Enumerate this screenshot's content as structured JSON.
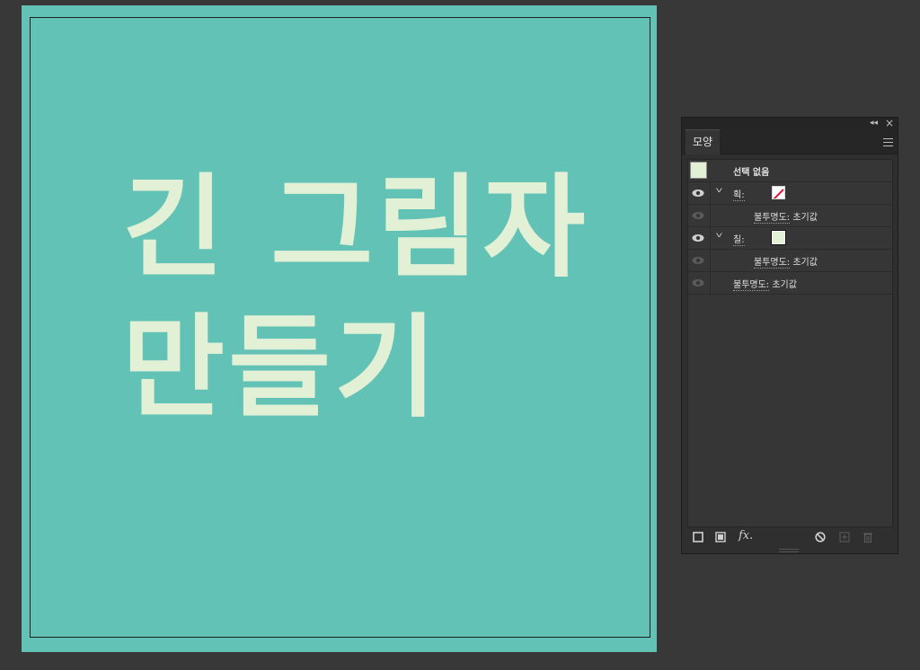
{
  "artboard": {
    "background": "#63c2b6",
    "text_color": "#e2f0d5",
    "headline": "긴 그림자\n만들기"
  },
  "panel": {
    "tab_label": "모양",
    "rows": {
      "no_selection": "선택 없음",
      "stroke_label": "획:",
      "stroke_opacity": "불투명도:",
      "stroke_opacity_value": "초기값",
      "fill_label": "칠:",
      "fill_opacity": "불투명도:",
      "fill_opacity_value": "초기값",
      "object_opacity": "불투명도:",
      "object_opacity_value": "초기값"
    },
    "fill_color": "#e2f0d5",
    "fx_label": "fx."
  }
}
